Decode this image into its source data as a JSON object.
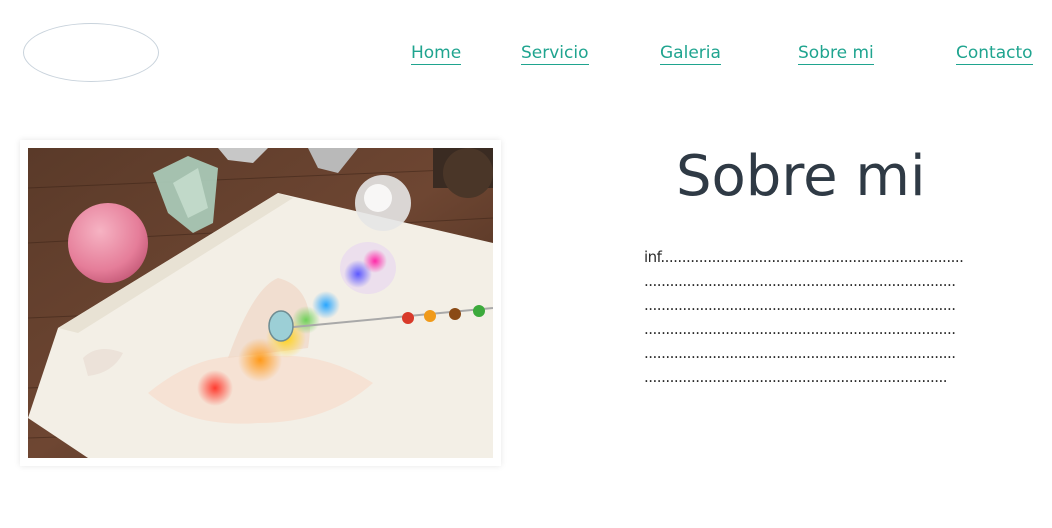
{
  "header": {
    "nav": [
      {
        "label": "Home"
      },
      {
        "label": "Servicio"
      },
      {
        "label": "Galeria"
      },
      {
        "label": "Sobre mi"
      },
      {
        "label": "Contacto"
      }
    ]
  },
  "about": {
    "title": "Sobre mi",
    "lines": [
      "inf.......................................................................",
      ".........................................................................",
      ".........................................................................",
      ".........................................................................",
      ".........................................................................",
      "......................................................................."
    ]
  },
  "colors": {
    "nav_link": "#1fa48f",
    "title": "#2f3a45",
    "logo_border": "#c9d3dc"
  }
}
